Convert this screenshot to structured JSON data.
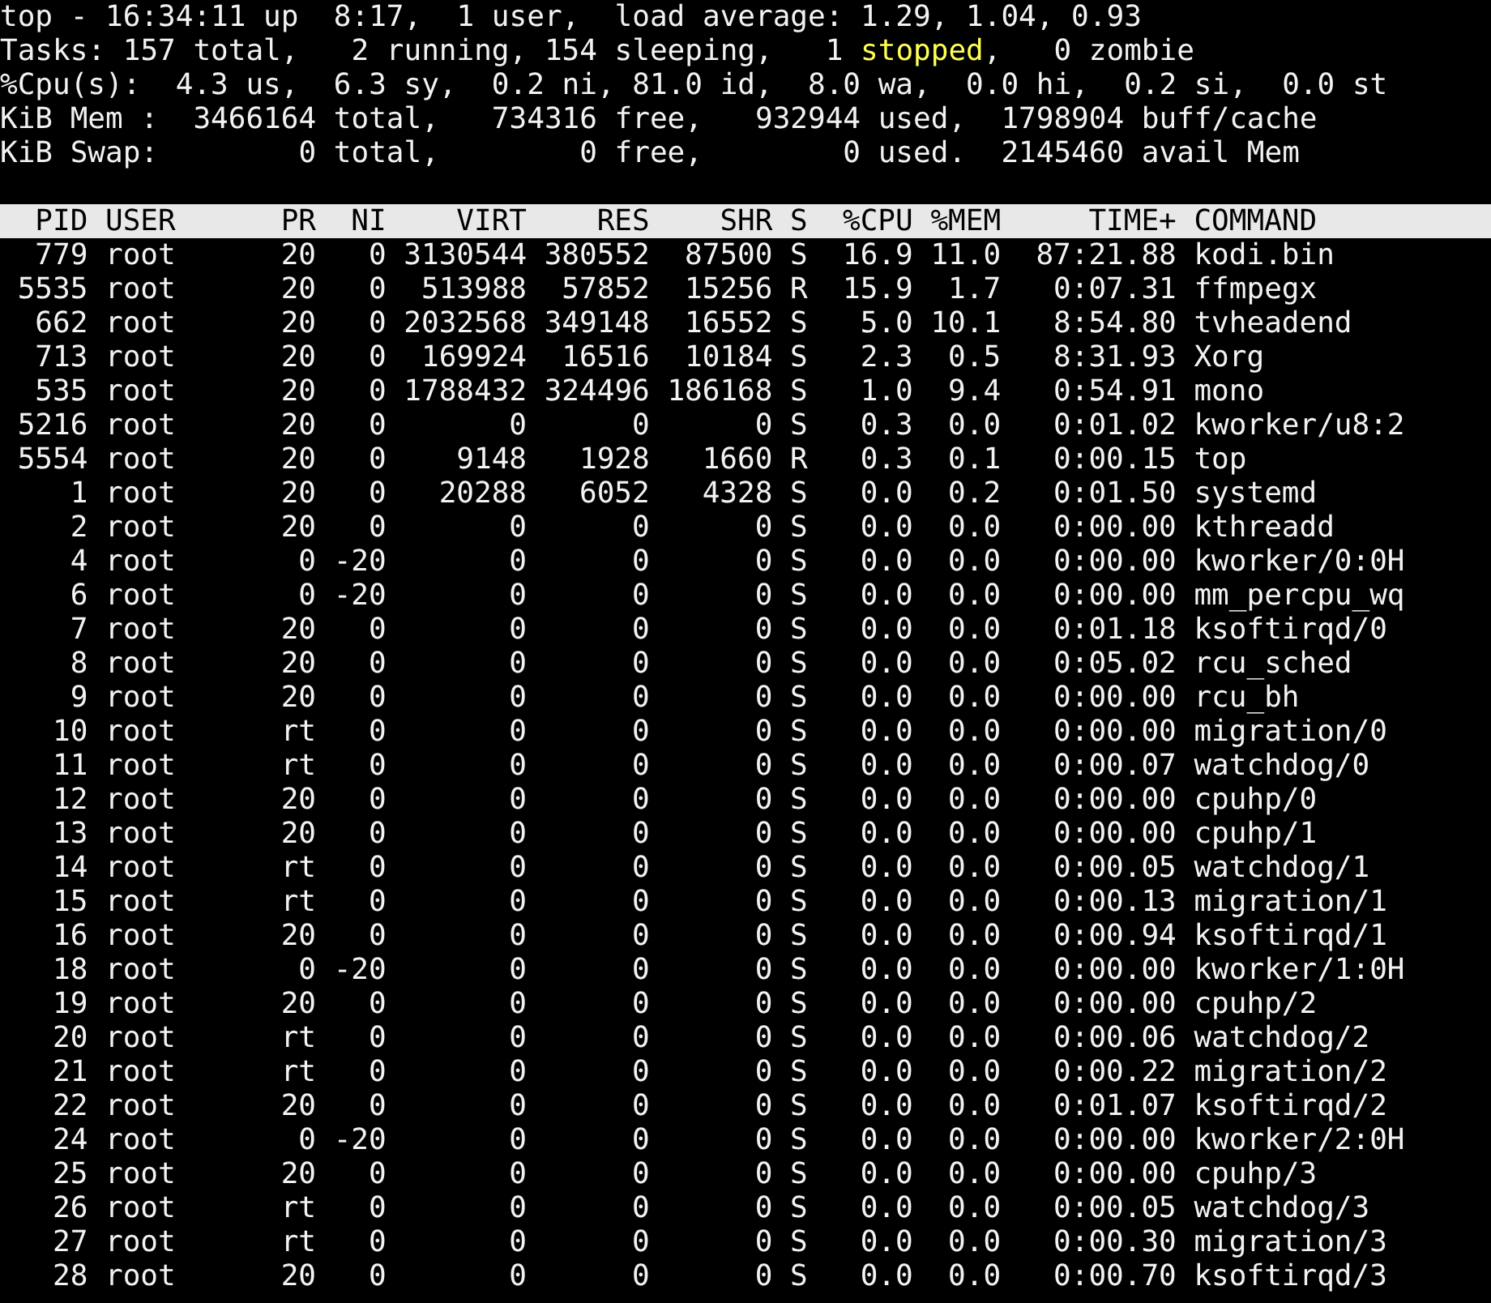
{
  "summary": [
    {
      "segments": [
        {
          "text": "top - 16:34:11 up  8:17,  1 user,  load average: 1.29, 1.04, 0.93",
          "highlight": false
        }
      ]
    },
    {
      "segments": [
        {
          "text": "Tasks: 157 total,   2 running, 154 sleeping,   1 ",
          "highlight": false
        },
        {
          "text": "stopped",
          "highlight": true
        },
        {
          "text": ",   0 zombie",
          "highlight": false
        }
      ]
    },
    {
      "segments": [
        {
          "text": "%Cpu(s):  4.3 us,  6.3 sy,  0.2 ni, 81.0 id,  8.0 wa,  0.0 hi,  0.2 si,  0.0 st",
          "highlight": false
        }
      ]
    },
    {
      "segments": [
        {
          "text": "KiB Mem :  3466164 total,   734316 free,   932944 used,  1798904 buff/cache",
          "highlight": false
        }
      ]
    },
    {
      "segments": [
        {
          "text": "KiB Swap:        0 total,        0 free,        0 used.  2145460 avail Mem",
          "highlight": false
        }
      ]
    }
  ],
  "table": {
    "columns": [
      "PID",
      "USER",
      "PR",
      "NI",
      "VIRT",
      "RES",
      "SHR",
      "S",
      "%CPU",
      "%MEM",
      "TIME+",
      "COMMAND"
    ],
    "rows": [
      [
        "779",
        "root",
        "20",
        "0",
        "3130544",
        "380552",
        "87500",
        "S",
        "16.9",
        "11.0",
        "87:21.88",
        "kodi.bin"
      ],
      [
        "5535",
        "root",
        "20",
        "0",
        "513988",
        "57852",
        "15256",
        "R",
        "15.9",
        "1.7",
        "0:07.31",
        "ffmpegx"
      ],
      [
        "662",
        "root",
        "20",
        "0",
        "2032568",
        "349148",
        "16552",
        "S",
        "5.0",
        "10.1",
        "8:54.80",
        "tvheadend"
      ],
      [
        "713",
        "root",
        "20",
        "0",
        "169924",
        "16516",
        "10184",
        "S",
        "2.3",
        "0.5",
        "8:31.93",
        "Xorg"
      ],
      [
        "535",
        "root",
        "20",
        "0",
        "1788432",
        "324496",
        "186168",
        "S",
        "1.0",
        "9.4",
        "0:54.91",
        "mono"
      ],
      [
        "5216",
        "root",
        "20",
        "0",
        "0",
        "0",
        "0",
        "S",
        "0.3",
        "0.0",
        "0:01.02",
        "kworker/u8:2"
      ],
      [
        "5554",
        "root",
        "20",
        "0",
        "9148",
        "1928",
        "1660",
        "R",
        "0.3",
        "0.1",
        "0:00.15",
        "top"
      ],
      [
        "1",
        "root",
        "20",
        "0",
        "20288",
        "6052",
        "4328",
        "S",
        "0.0",
        "0.2",
        "0:01.50",
        "systemd"
      ],
      [
        "2",
        "root",
        "20",
        "0",
        "0",
        "0",
        "0",
        "S",
        "0.0",
        "0.0",
        "0:00.00",
        "kthreadd"
      ],
      [
        "4",
        "root",
        "0",
        "-20",
        "0",
        "0",
        "0",
        "S",
        "0.0",
        "0.0",
        "0:00.00",
        "kworker/0:0H"
      ],
      [
        "6",
        "root",
        "0",
        "-20",
        "0",
        "0",
        "0",
        "S",
        "0.0",
        "0.0",
        "0:00.00",
        "mm_percpu_wq"
      ],
      [
        "7",
        "root",
        "20",
        "0",
        "0",
        "0",
        "0",
        "S",
        "0.0",
        "0.0",
        "0:01.18",
        "ksoftirqd/0"
      ],
      [
        "8",
        "root",
        "20",
        "0",
        "0",
        "0",
        "0",
        "S",
        "0.0",
        "0.0",
        "0:05.02",
        "rcu_sched"
      ],
      [
        "9",
        "root",
        "20",
        "0",
        "0",
        "0",
        "0",
        "S",
        "0.0",
        "0.0",
        "0:00.00",
        "rcu_bh"
      ],
      [
        "10",
        "root",
        "rt",
        "0",
        "0",
        "0",
        "0",
        "S",
        "0.0",
        "0.0",
        "0:00.00",
        "migration/0"
      ],
      [
        "11",
        "root",
        "rt",
        "0",
        "0",
        "0",
        "0",
        "S",
        "0.0",
        "0.0",
        "0:00.07",
        "watchdog/0"
      ],
      [
        "12",
        "root",
        "20",
        "0",
        "0",
        "0",
        "0",
        "S",
        "0.0",
        "0.0",
        "0:00.00",
        "cpuhp/0"
      ],
      [
        "13",
        "root",
        "20",
        "0",
        "0",
        "0",
        "0",
        "S",
        "0.0",
        "0.0",
        "0:00.00",
        "cpuhp/1"
      ],
      [
        "14",
        "root",
        "rt",
        "0",
        "0",
        "0",
        "0",
        "S",
        "0.0",
        "0.0",
        "0:00.05",
        "watchdog/1"
      ],
      [
        "15",
        "root",
        "rt",
        "0",
        "0",
        "0",
        "0",
        "S",
        "0.0",
        "0.0",
        "0:00.13",
        "migration/1"
      ],
      [
        "16",
        "root",
        "20",
        "0",
        "0",
        "0",
        "0",
        "S",
        "0.0",
        "0.0",
        "0:00.94",
        "ksoftirqd/1"
      ],
      [
        "18",
        "root",
        "0",
        "-20",
        "0",
        "0",
        "0",
        "S",
        "0.0",
        "0.0",
        "0:00.00",
        "kworker/1:0H"
      ],
      [
        "19",
        "root",
        "20",
        "0",
        "0",
        "0",
        "0",
        "S",
        "0.0",
        "0.0",
        "0:00.00",
        "cpuhp/2"
      ],
      [
        "20",
        "root",
        "rt",
        "0",
        "0",
        "0",
        "0",
        "S",
        "0.0",
        "0.0",
        "0:00.06",
        "watchdog/2"
      ],
      [
        "21",
        "root",
        "rt",
        "0",
        "0",
        "0",
        "0",
        "S",
        "0.0",
        "0.0",
        "0:00.22",
        "migration/2"
      ],
      [
        "22",
        "root",
        "20",
        "0",
        "0",
        "0",
        "0",
        "S",
        "0.0",
        "0.0",
        "0:01.07",
        "ksoftirqd/2"
      ],
      [
        "24",
        "root",
        "0",
        "-20",
        "0",
        "0",
        "0",
        "S",
        "0.0",
        "0.0",
        "0:00.00",
        "kworker/2:0H"
      ],
      [
        "25",
        "root",
        "20",
        "0",
        "0",
        "0",
        "0",
        "S",
        "0.0",
        "0.0",
        "0:00.00",
        "cpuhp/3"
      ],
      [
        "26",
        "root",
        "rt",
        "0",
        "0",
        "0",
        "0",
        "S",
        "0.0",
        "0.0",
        "0:00.05",
        "watchdog/3"
      ],
      [
        "27",
        "root",
        "rt",
        "0",
        "0",
        "0",
        "0",
        "S",
        "0.0",
        "0.0",
        "0:00.30",
        "migration/3"
      ],
      [
        "28",
        "root",
        "20",
        "0",
        "0",
        "0",
        "0",
        "S",
        "0.0",
        "0.0",
        "0:00.70",
        "ksoftirqd/3"
      ]
    ]
  }
}
